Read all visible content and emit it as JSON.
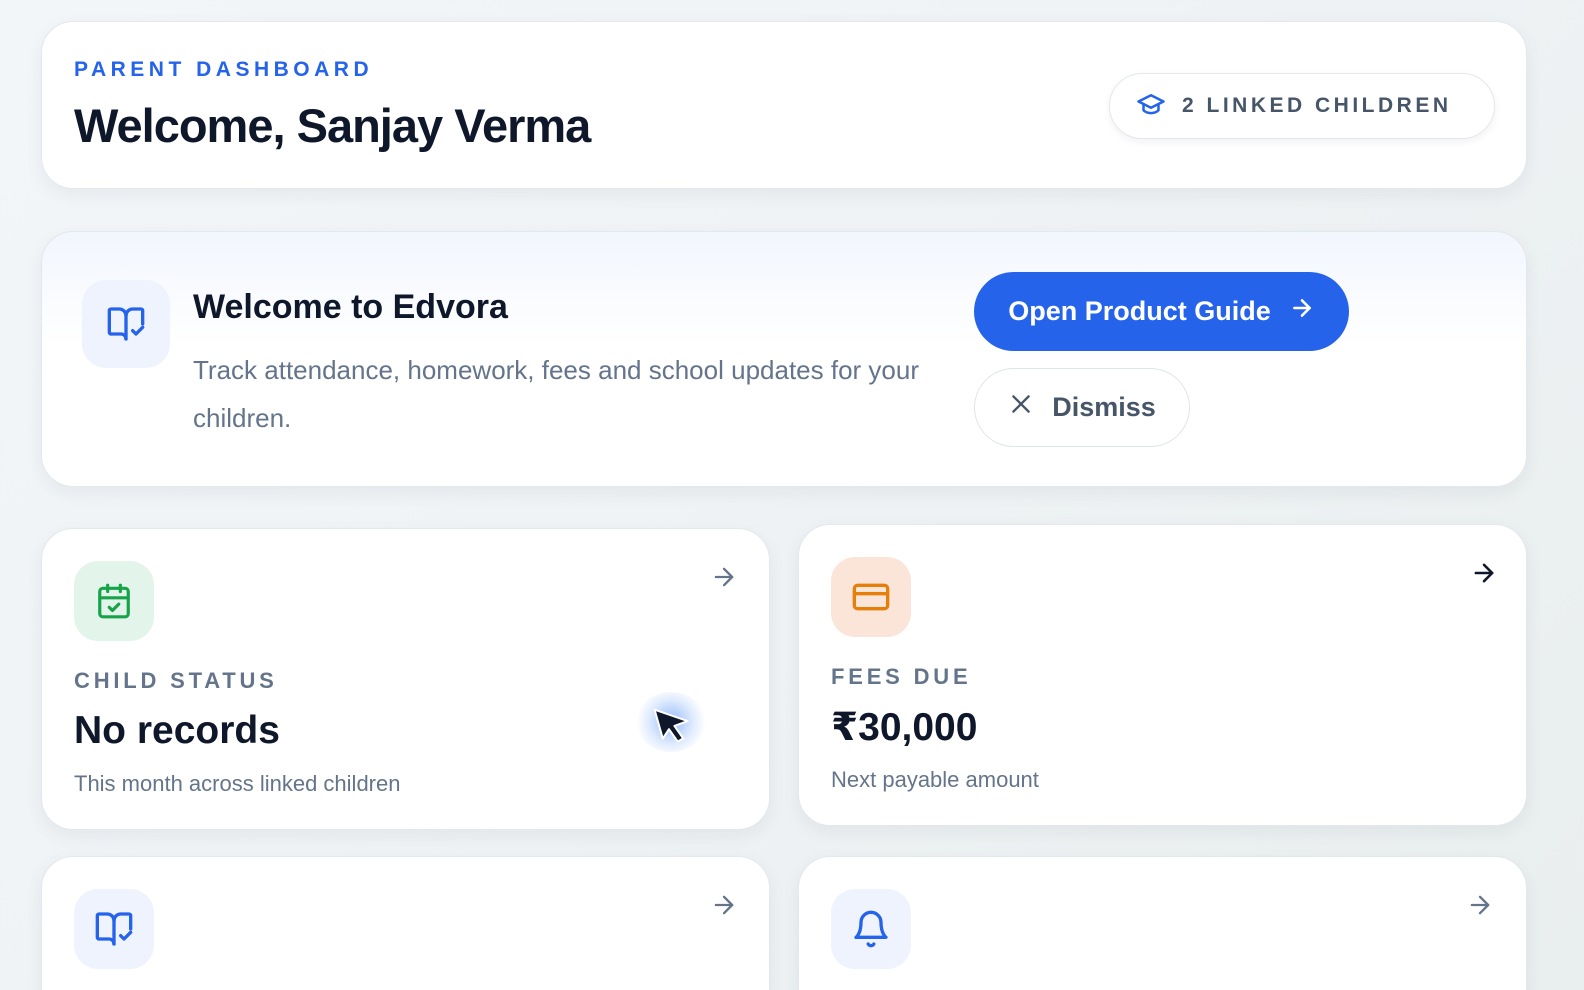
{
  "header": {
    "eyebrow": "PARENT DASHBOARD",
    "title": "Welcome, Sanjay Verma",
    "linked_children_label": "2 LINKED CHILDREN",
    "linked_children_icon": "graduation-cap-icon"
  },
  "welcome_banner": {
    "icon": "book-check-icon",
    "title": "Welcome to Edvora",
    "description": "Track attendance, homework, fees and school updates for your children.",
    "primary_button": "Open Product Guide",
    "secondary_button": "Dismiss"
  },
  "stats": {
    "child_status": {
      "icon": "calendar-check-icon",
      "label": "CHILD STATUS",
      "value": "No records",
      "caption": "This month across linked children"
    },
    "fees_due": {
      "icon": "credit-card-icon",
      "label": "FEES DUE",
      "value": "₹30,000",
      "caption": "Next payable amount"
    },
    "homework": {
      "icon": "book-check-icon"
    },
    "notices": {
      "icon": "bell-icon"
    }
  },
  "colors": {
    "accent": "#2563eb",
    "green_icon_bg": "#e3f4ea",
    "green_icon": "#16a34a",
    "orange_icon_bg": "#fbe5d8",
    "orange_icon": "#e67e0a",
    "blue_icon_bg": "#eef3fd"
  }
}
